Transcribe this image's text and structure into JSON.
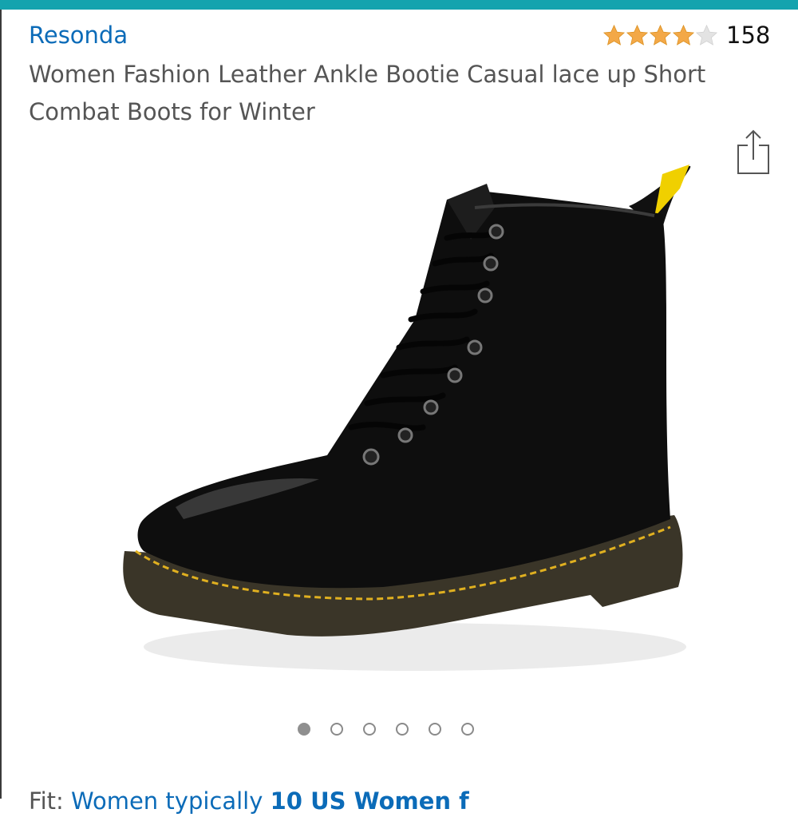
{
  "header": {
    "accent_color": "#14a3ae"
  },
  "product": {
    "brand": "Resonda",
    "title": "Women Fashion Leather Ankle Bootie Casual lace up Short Combat Boots for Winter",
    "rating": 4,
    "rating_max": 5,
    "review_count": "158",
    "star_color": "#f3a847",
    "image": "black-leather-combat-boot",
    "share_icon": "share-icon"
  },
  "carousel": {
    "total": 6,
    "active": 1
  },
  "fit": {
    "label": "Fit:",
    "value_prefix": "Women typically ",
    "value_bold": "10 US Women f"
  }
}
